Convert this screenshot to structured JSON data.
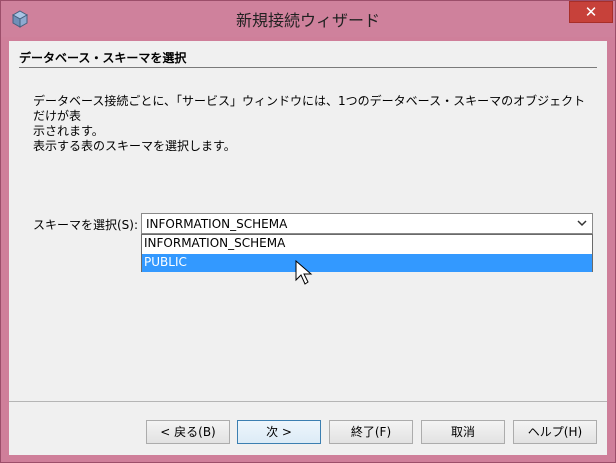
{
  "window": {
    "title": "新規接続ウィザード",
    "close_label": "✕"
  },
  "panel": {
    "heading": "データベース・スキーマを選択",
    "description": "データベース接続ごとに、「サービス」ウィンドウには、1つのデータベース・スキーマのオブジェクトだけが表\n示されます。\n表示する表のスキーマを選択します。"
  },
  "schema": {
    "label": "スキーマを選択(S):",
    "selected": "INFORMATION_SCHEMA",
    "options": [
      "INFORMATION_SCHEMA",
      "PUBLIC"
    ],
    "highlighted_index": 1
  },
  "buttons": {
    "back": "< 戻る(B)",
    "next": "次 >",
    "finish": "終了(F)",
    "cancel": "取消",
    "help": "ヘルプ(H)"
  }
}
